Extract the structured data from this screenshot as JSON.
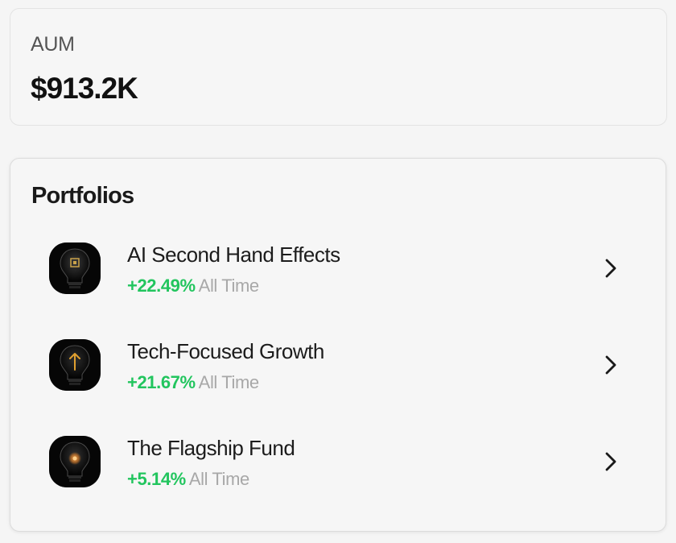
{
  "aum": {
    "label": "AUM",
    "value": "$913.2K"
  },
  "portfolios": {
    "title": "Portfolios",
    "items": [
      {
        "name": "AI Second Hand Effects",
        "change": "+22.49%",
        "period": "All Time",
        "icon": "lightbulb-chip-icon",
        "accent": "#c9a24a"
      },
      {
        "name": "Tech-Focused Growth",
        "change": "+21.67%",
        "period": "All Time",
        "icon": "lightbulb-arrow-icon",
        "accent": "#e0a030"
      },
      {
        "name": "The Flagship Fund",
        "change": "+5.14%",
        "period": "All Time",
        "icon": "lightbulb-glow-icon",
        "accent": "#f08a2a"
      }
    ]
  },
  "colors": {
    "positive": "#22c55e",
    "muted": "#a8a8a8",
    "background": "#f5f5f5"
  }
}
